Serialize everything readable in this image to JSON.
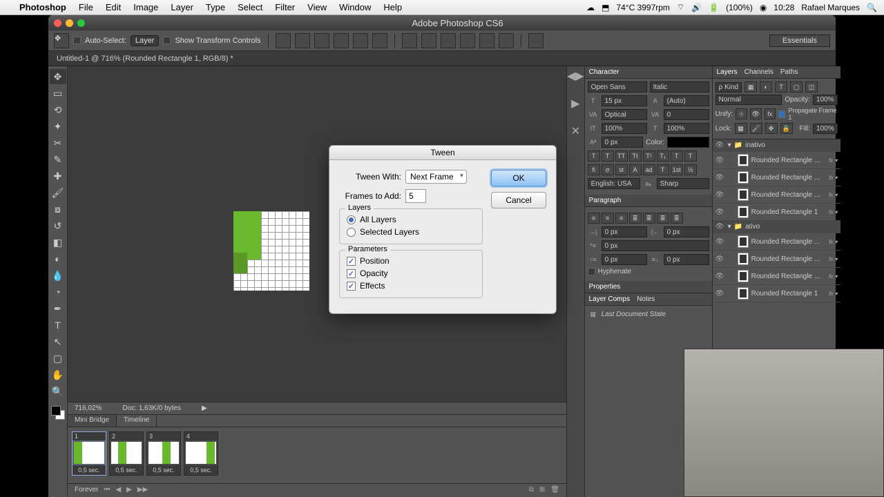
{
  "menubar": {
    "apple": "",
    "app": "Photoshop",
    "items": [
      "File",
      "Edit",
      "Image",
      "Layer",
      "Type",
      "Select",
      "Filter",
      "View",
      "Window",
      "Help"
    ],
    "temp_rpm": "74°C 3997rpm",
    "battery": "(100%)",
    "time": "10:28",
    "user": "Rafael Marques"
  },
  "window": {
    "title": "Adobe Photoshop CS6"
  },
  "optbar": {
    "auto_select": "Auto-Select:",
    "auto_select_val": "Layer",
    "show_transform": "Show Transform Controls",
    "workspace": "Essentials"
  },
  "doctab": "Untitled-1 @ 716% (Rounded Rectangle 1, RGB/8) *",
  "status": {
    "zoom": "716,02%",
    "doc": "Doc: 1,63K/0 bytes"
  },
  "timeline": {
    "tabs": [
      "Mini Bridge",
      "Timeline"
    ],
    "frames": [
      {
        "n": "1",
        "dur": "0,5 sec."
      },
      {
        "n": "2",
        "dur": "0,5 sec."
      },
      {
        "n": "3",
        "dur": "0,5 sec."
      },
      {
        "n": "4",
        "dur": "0,5 sec."
      }
    ],
    "loop": "Forever"
  },
  "char": {
    "title": "Character",
    "font": "Open Sans",
    "style": "Italic",
    "size": "15 px",
    "leading": "(Auto)",
    "kern": "Optical",
    "track": "0",
    "vscale": "100%",
    "hscale": "100%",
    "baseline": "0 px",
    "color_label": "Color:",
    "lang": "English: USA",
    "aa": "Sharp"
  },
  "para": {
    "title": "Paragraph",
    "l": "0 px",
    "r": "0 px",
    "fl": "0 px",
    "sb": "0 px",
    "sa": "0 px",
    "hyphen": "Hyphenate"
  },
  "props": {
    "title": "Properties"
  },
  "comps": {
    "tab1": "Layer Comps",
    "tab2": "Notes",
    "item": "Last Document State"
  },
  "layers": {
    "tabs": [
      "Layers",
      "Channels",
      "Paths"
    ],
    "kind": "Kind",
    "mode": "Normal",
    "opacity_label": "Opacity:",
    "opacity": "100%",
    "unify": "Unify:",
    "propagate": "Propagate Frame 1",
    "lock": "Lock:",
    "fill_label": "Fill:",
    "fill": "100%",
    "groups": [
      {
        "name": "inativo",
        "items": [
          "Rounded Rectangle ...",
          "Rounded Rectangle ...",
          "Rounded Rectangle ...",
          "Rounded Rectangle 1"
        ]
      },
      {
        "name": "ativo",
        "items": [
          "Rounded Rectangle ...",
          "Rounded Rectangle ...",
          "Rounded Rectangle ...",
          "Rounded Rectangle 1"
        ]
      }
    ]
  },
  "dialog": {
    "title": "Tween",
    "tween_with_label": "Tween With:",
    "tween_with": "Next Frame",
    "frames_label": "Frames to Add:",
    "frames_val": "5",
    "layers_legend": "Layers",
    "all_layers": "All Layers",
    "sel_layers": "Selected Layers",
    "params_legend": "Parameters",
    "position": "Position",
    "opacity": "Opacity",
    "effects": "Effects",
    "ok": "OK",
    "cancel": "Cancel"
  }
}
